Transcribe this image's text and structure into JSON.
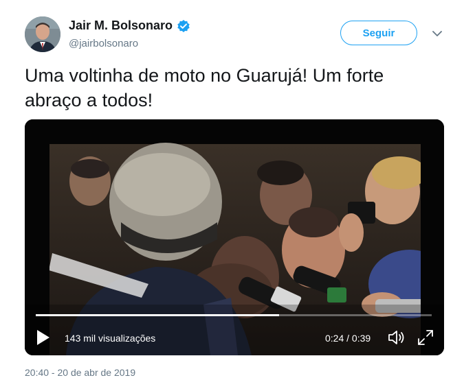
{
  "author": {
    "display_name": "Jair M. Bolsonaro",
    "handle": "@jairbolsonaro",
    "verified": true
  },
  "follow_label": "Seguir",
  "tweet_text": "Uma voltinha de moto no Guarujá! Um forte abraço a todos!",
  "video": {
    "views": "143 mil visualizações",
    "time": "0:24 / 0:39",
    "progress": 0.615
  },
  "timestamp": "20:40 - 20 de abr de 2019",
  "colors": {
    "accent": "#1da1f2",
    "text": "#14171a",
    "muted": "#657786"
  },
  "icons": {
    "verified": "verified-badge-icon",
    "caret": "chevron-down-icon",
    "play": "play-icon",
    "volume": "volume-icon",
    "fullscreen": "fullscreen-icon"
  }
}
